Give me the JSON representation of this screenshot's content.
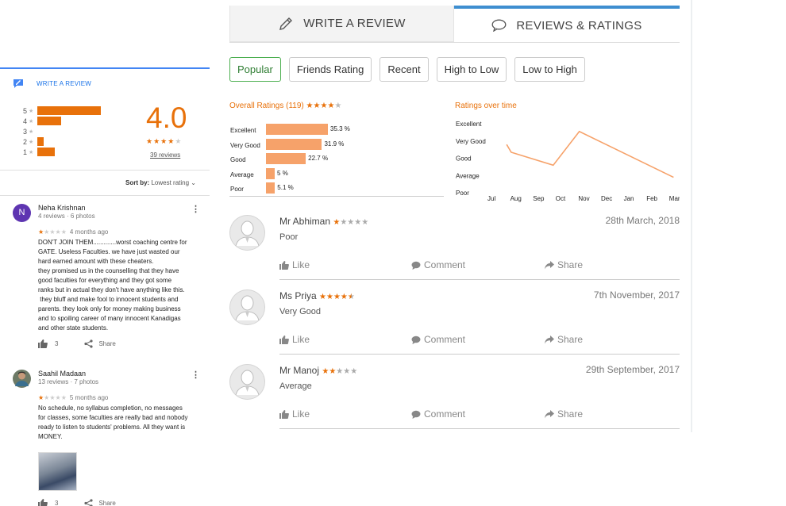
{
  "left": {
    "write_review": "WRITE A REVIEW",
    "score": "4.0",
    "stars_filled": 4,
    "reviews_link": "39 reviews",
    "histogram": [
      {
        "star": "5",
        "percent": 100
      },
      {
        "star": "4",
        "percent": 37
      },
      {
        "star": "3",
        "percent": 0
      },
      {
        "star": "2",
        "percent": 10
      },
      {
        "star": "1",
        "percent": 27
      }
    ],
    "sort_label": "Sort by:",
    "sort_value": "Lowest rating",
    "reviews": [
      {
        "initial": "N",
        "name": "Neha Krishnan",
        "meta": "4 reviews · 6 photos",
        "rating": 1,
        "ago": "4 months ago",
        "lines": [
          "DON'T JOIN THEM.............worst coaching centre for",
          "GATE. Useless Faculties. we have just wasted our",
          "hard earned amount with these cheaters.",
          "they promised us in the counselling that they have",
          "good faculties for everything and they got some",
          "ranks but in actual they don't have anything like this.",
          " they bluff and make fool to innocent students and",
          "parents. they look only for money making business",
          "and to spoiling career of many innocent Kanadigas",
          "and other state students."
        ],
        "likes": "3",
        "share": "Share"
      },
      {
        "initial": "",
        "name": "Saahil Madaan",
        "meta": "13 reviews · 7 photos",
        "rating": 1,
        "ago": "5 months ago",
        "lines": [
          "No schedule, no syllabus completion, no messages",
          "for classes, some faculties are really bad and nobody",
          "ready to listen to students' problems. All they want is",
          "MONEY."
        ],
        "likes": "3",
        "share": "Share"
      }
    ]
  },
  "tabs": {
    "write": "WRITE A REVIEW",
    "reviews": "REVIEWS & RATINGS"
  },
  "filters": [
    "Popular",
    "Friends Rating",
    "Recent",
    "High to Low",
    "Low to High"
  ],
  "overall": {
    "title": "Overall Ratings (119)",
    "stars_filled": 4
  },
  "chart_data": [
    {
      "type": "bar",
      "orientation": "horizontal",
      "title": "Overall Ratings (119)",
      "categories": [
        "Excellent",
        "Very Good",
        "Good",
        "Average",
        "Poor"
      ],
      "values": [
        35.3,
        31.9,
        22.7,
        5,
        5.1
      ],
      "value_labels": [
        "35.3 %",
        "31.9 %",
        "22.7 %",
        "5 %",
        "5.1 %"
      ],
      "color": "#f6a26a",
      "xlim": [
        0,
        35.3
      ]
    },
    {
      "type": "line",
      "title": "Ratings over time",
      "x": [
        "Jul",
        "Aug",
        "Sep",
        "Oct",
        "Nov",
        "Dec",
        "Jan",
        "Feb",
        "Mar"
      ],
      "y_categories": [
        "Excellent",
        "Very Good",
        "Good",
        "Average",
        "Poor"
      ],
      "points": [
        {
          "x": 0.6,
          "y": 3.8
        },
        {
          "x": 0.8,
          "y": 3.35
        },
        {
          "x": 2.65,
          "y": 2.6
        },
        {
          "x": 3.8,
          "y": 4.55
        },
        {
          "x": 7.95,
          "y": 1.9
        }
      ],
      "color": "#f6a26a",
      "grid": false
    }
  ],
  "reviews": [
    {
      "name": "Mr Abhiman",
      "rating": 1,
      "date": "28th March, 2018",
      "text": "Poor"
    },
    {
      "name": "Ms Priya",
      "rating": 4.5,
      "date": "7th November, 2017",
      "text": "Very Good"
    },
    {
      "name": "Mr Manoj",
      "rating": 2,
      "date": "29th September, 2017",
      "text": "Average"
    }
  ],
  "actions": {
    "like": "Like",
    "comment": "Comment",
    "share": "Share"
  },
  "colors": {
    "accent": "#e8710a",
    "bar": "#f6a26a",
    "tab_active": "#3e8ed0",
    "google_blue": "#1a73e8",
    "popular": "#4caf50"
  }
}
